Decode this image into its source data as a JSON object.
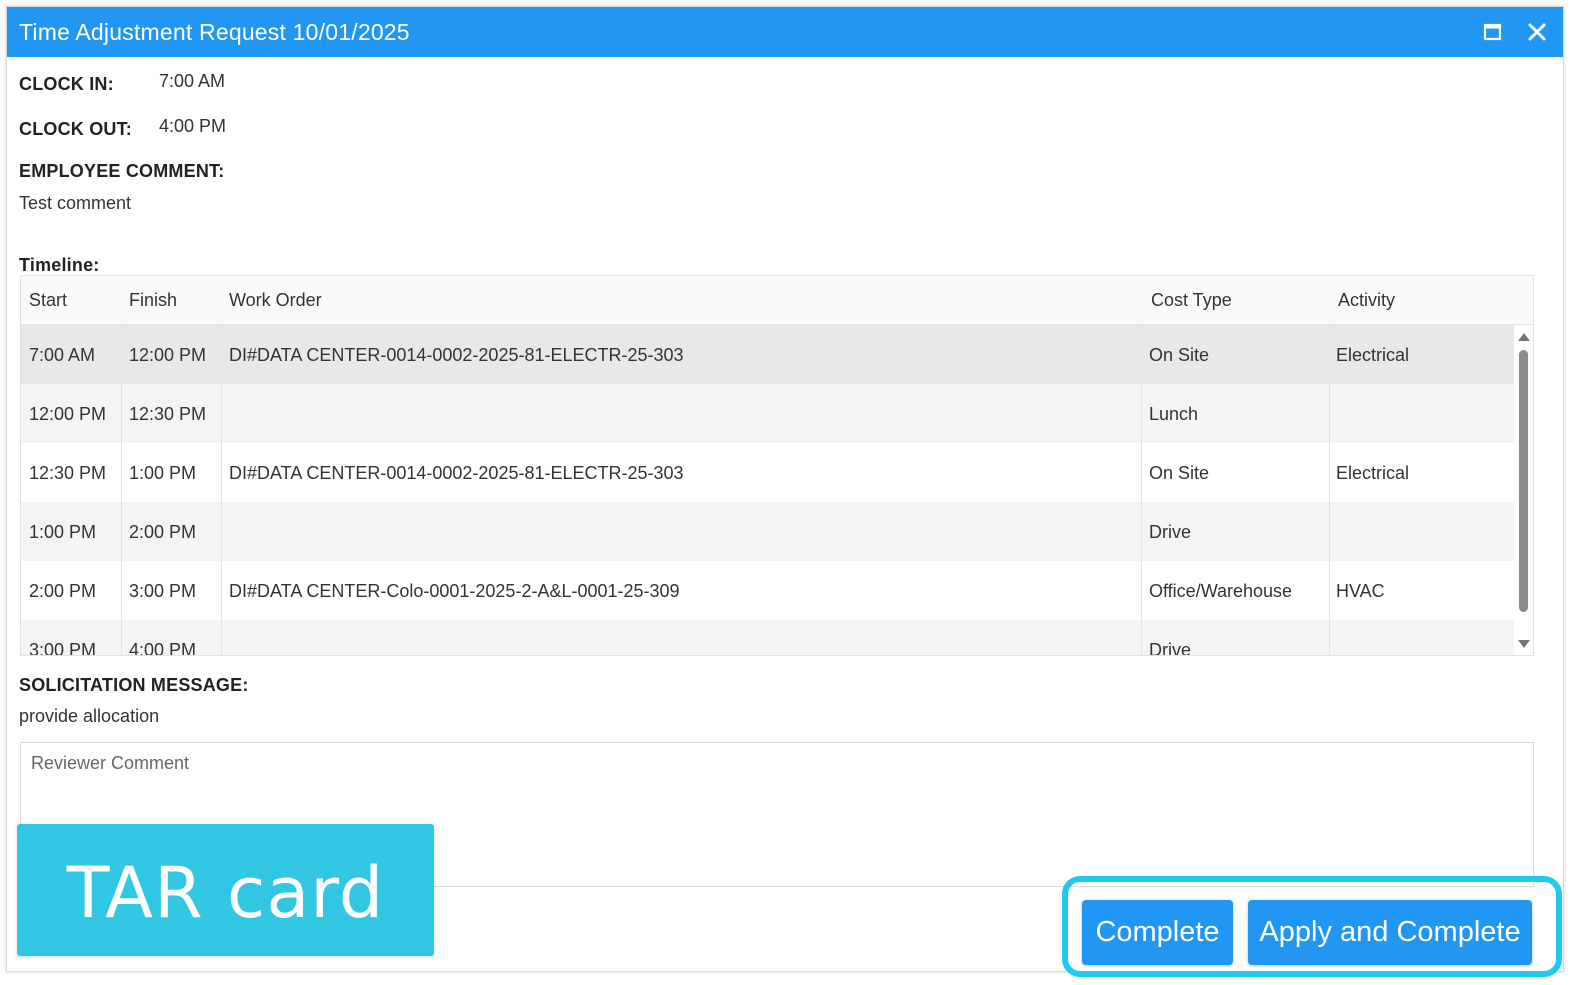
{
  "dialog": {
    "title": "Time Adjustment Request 10/01/2025",
    "maximize_icon": "maximize-icon",
    "close_icon": "close-icon",
    "accent_color": "#2196f3"
  },
  "clock_in": {
    "label": "CLOCK IN:",
    "value": "7:00 AM"
  },
  "clock_out": {
    "label": "CLOCK OUT:",
    "value": "4:00 PM"
  },
  "employee_comment": {
    "label": "EMPLOYEE COMMENT:",
    "value": "Test comment"
  },
  "timeline": {
    "label": "Timeline:",
    "columns": [
      "Start",
      "Finish",
      "Work Order",
      "Cost Type",
      "Activity"
    ],
    "rows": [
      {
        "start": "7:00 AM",
        "finish": "12:00 PM",
        "work_order": "DI#DATA CENTER-0014-0002-2025-81-ELECTR-25-303",
        "cost_type": "On Site",
        "activity": "Electrical"
      },
      {
        "start": "12:00 PM",
        "finish": "12:30 PM",
        "work_order": "",
        "cost_type": "Lunch",
        "activity": ""
      },
      {
        "start": "12:30 PM",
        "finish": "1:00 PM",
        "work_order": "DI#DATA CENTER-0014-0002-2025-81-ELECTR-25-303",
        "cost_type": "On Site",
        "activity": "Electrical"
      },
      {
        "start": "1:00 PM",
        "finish": "2:00 PM",
        "work_order": "",
        "cost_type": "Drive",
        "activity": ""
      },
      {
        "start": "2:00 PM",
        "finish": "3:00 PM",
        "work_order": "DI#DATA CENTER-Colo-0001-2025-2-A&L-0001-25-309",
        "cost_type": "Office/Warehouse",
        "activity": "HVAC"
      },
      {
        "start": "3:00 PM",
        "finish": "4:00 PM",
        "work_order": "",
        "cost_type": "Drive",
        "activity": ""
      }
    ]
  },
  "solicitation": {
    "label": "SOLICITATION MESSAGE:",
    "value": "provide allocation"
  },
  "reviewer_comment": {
    "placeholder": "Reviewer Comment",
    "value": ""
  },
  "overlay": {
    "tar_card_label": "TAR card",
    "highlight_color": "#1fc9ef"
  },
  "actions": {
    "complete_label": "Complete",
    "apply_complete_label": "Apply and Complete"
  }
}
